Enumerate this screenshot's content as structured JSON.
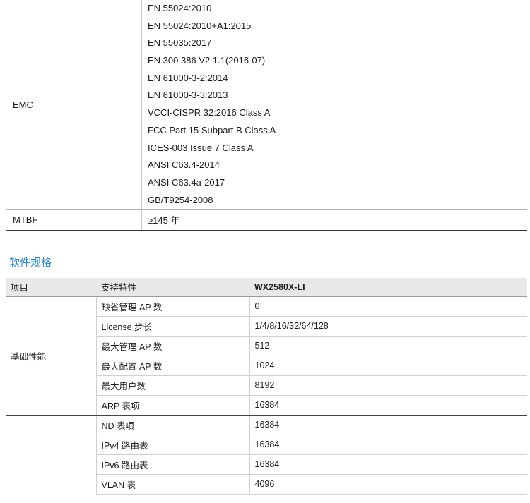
{
  "hardware": {
    "emc_label": "EMC",
    "emc_standards": [
      "EN 55024:2010",
      "EN 55024:2010+A1:2015",
      "EN 55035:2017",
      "EN 300 386 V2.1.1(2016-07)",
      "EN 61000-3-2:2014",
      "EN 61000-3-3:2013",
      "VCCI-CISPR 32:2016 Class A",
      "FCC Part 15 Subpart B Class A",
      "ICES-003 Issue 7 Class A",
      "ANSI C63.4-2014",
      "ANSI C63.4a-2017",
      "GB/T9254-2008"
    ],
    "mtbf_label": "MTBF",
    "mtbf_value": "≥145 年"
  },
  "software": {
    "section_title": "软件规格",
    "headers": {
      "item": "项目",
      "feature": "支持特性",
      "model": "WX2580X-LI"
    },
    "groups": [
      {
        "category": "基础性能",
        "rows": [
          {
            "feature": "缺省管理 AP 数",
            "value": "0"
          },
          {
            "feature": "License 步长",
            "value": "1/4/8/16/32/64/128"
          },
          {
            "feature": "最大管理 AP 数",
            "value": "512"
          },
          {
            "feature": "最大配置 AP 数",
            "value": "1024"
          },
          {
            "feature": "最大用户数",
            "value": "8192"
          },
          {
            "feature": "ARP 表项",
            "value": "16384"
          }
        ]
      },
      {
        "category": "",
        "rows": [
          {
            "feature": "ND 表项",
            "value": "16384"
          },
          {
            "feature": "IPv4 路由表",
            "value": "16384"
          },
          {
            "feature": "IPv6 路由表",
            "value": "16384"
          },
          {
            "feature": "VLAN 表",
            "value": "4096"
          }
        ]
      }
    ]
  }
}
